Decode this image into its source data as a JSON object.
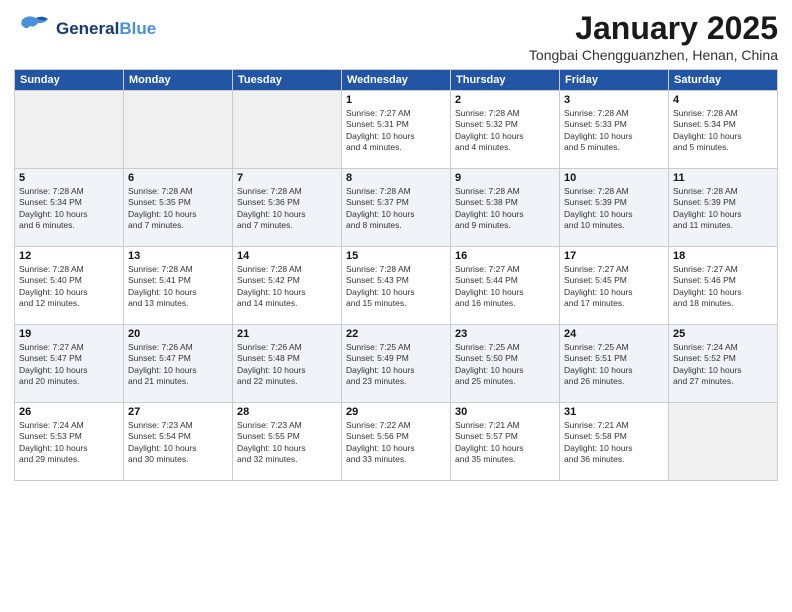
{
  "header": {
    "logo_general": "General",
    "logo_blue": "Blue",
    "month_title": "January 2025",
    "subtitle": "Tongbai Chengguanzhen, Henan, China"
  },
  "days_of_week": [
    "Sunday",
    "Monday",
    "Tuesday",
    "Wednesday",
    "Thursday",
    "Friday",
    "Saturday"
  ],
  "weeks": [
    [
      {
        "day": "",
        "lines": []
      },
      {
        "day": "",
        "lines": []
      },
      {
        "day": "",
        "lines": []
      },
      {
        "day": "1",
        "lines": [
          "Sunrise: 7:27 AM",
          "Sunset: 5:31 PM",
          "Daylight: 10 hours",
          "and 4 minutes."
        ]
      },
      {
        "day": "2",
        "lines": [
          "Sunrise: 7:28 AM",
          "Sunset: 5:32 PM",
          "Daylight: 10 hours",
          "and 4 minutes."
        ]
      },
      {
        "day": "3",
        "lines": [
          "Sunrise: 7:28 AM",
          "Sunset: 5:33 PM",
          "Daylight: 10 hours",
          "and 5 minutes."
        ]
      },
      {
        "day": "4",
        "lines": [
          "Sunrise: 7:28 AM",
          "Sunset: 5:34 PM",
          "Daylight: 10 hours",
          "and 5 minutes."
        ]
      }
    ],
    [
      {
        "day": "5",
        "lines": [
          "Sunrise: 7:28 AM",
          "Sunset: 5:34 PM",
          "Daylight: 10 hours",
          "and 6 minutes."
        ]
      },
      {
        "day": "6",
        "lines": [
          "Sunrise: 7:28 AM",
          "Sunset: 5:35 PM",
          "Daylight: 10 hours",
          "and 7 minutes."
        ]
      },
      {
        "day": "7",
        "lines": [
          "Sunrise: 7:28 AM",
          "Sunset: 5:36 PM",
          "Daylight: 10 hours",
          "and 7 minutes."
        ]
      },
      {
        "day": "8",
        "lines": [
          "Sunrise: 7:28 AM",
          "Sunset: 5:37 PM",
          "Daylight: 10 hours",
          "and 8 minutes."
        ]
      },
      {
        "day": "9",
        "lines": [
          "Sunrise: 7:28 AM",
          "Sunset: 5:38 PM",
          "Daylight: 10 hours",
          "and 9 minutes."
        ]
      },
      {
        "day": "10",
        "lines": [
          "Sunrise: 7:28 AM",
          "Sunset: 5:39 PM",
          "Daylight: 10 hours",
          "and 10 minutes."
        ]
      },
      {
        "day": "11",
        "lines": [
          "Sunrise: 7:28 AM",
          "Sunset: 5:39 PM",
          "Daylight: 10 hours",
          "and 11 minutes."
        ]
      }
    ],
    [
      {
        "day": "12",
        "lines": [
          "Sunrise: 7:28 AM",
          "Sunset: 5:40 PM",
          "Daylight: 10 hours",
          "and 12 minutes."
        ]
      },
      {
        "day": "13",
        "lines": [
          "Sunrise: 7:28 AM",
          "Sunset: 5:41 PM",
          "Daylight: 10 hours",
          "and 13 minutes."
        ]
      },
      {
        "day": "14",
        "lines": [
          "Sunrise: 7:28 AM",
          "Sunset: 5:42 PM",
          "Daylight: 10 hours",
          "and 14 minutes."
        ]
      },
      {
        "day": "15",
        "lines": [
          "Sunrise: 7:28 AM",
          "Sunset: 5:43 PM",
          "Daylight: 10 hours",
          "and 15 minutes."
        ]
      },
      {
        "day": "16",
        "lines": [
          "Sunrise: 7:27 AM",
          "Sunset: 5:44 PM",
          "Daylight: 10 hours",
          "and 16 minutes."
        ]
      },
      {
        "day": "17",
        "lines": [
          "Sunrise: 7:27 AM",
          "Sunset: 5:45 PM",
          "Daylight: 10 hours",
          "and 17 minutes."
        ]
      },
      {
        "day": "18",
        "lines": [
          "Sunrise: 7:27 AM",
          "Sunset: 5:46 PM",
          "Daylight: 10 hours",
          "and 18 minutes."
        ]
      }
    ],
    [
      {
        "day": "19",
        "lines": [
          "Sunrise: 7:27 AM",
          "Sunset: 5:47 PM",
          "Daylight: 10 hours",
          "and 20 minutes."
        ]
      },
      {
        "day": "20",
        "lines": [
          "Sunrise: 7:26 AM",
          "Sunset: 5:47 PM",
          "Daylight: 10 hours",
          "and 21 minutes."
        ]
      },
      {
        "day": "21",
        "lines": [
          "Sunrise: 7:26 AM",
          "Sunset: 5:48 PM",
          "Daylight: 10 hours",
          "and 22 minutes."
        ]
      },
      {
        "day": "22",
        "lines": [
          "Sunrise: 7:25 AM",
          "Sunset: 5:49 PM",
          "Daylight: 10 hours",
          "and 23 minutes."
        ]
      },
      {
        "day": "23",
        "lines": [
          "Sunrise: 7:25 AM",
          "Sunset: 5:50 PM",
          "Daylight: 10 hours",
          "and 25 minutes."
        ]
      },
      {
        "day": "24",
        "lines": [
          "Sunrise: 7:25 AM",
          "Sunset: 5:51 PM",
          "Daylight: 10 hours",
          "and 26 minutes."
        ]
      },
      {
        "day": "25",
        "lines": [
          "Sunrise: 7:24 AM",
          "Sunset: 5:52 PM",
          "Daylight: 10 hours",
          "and 27 minutes."
        ]
      }
    ],
    [
      {
        "day": "26",
        "lines": [
          "Sunrise: 7:24 AM",
          "Sunset: 5:53 PM",
          "Daylight: 10 hours",
          "and 29 minutes."
        ]
      },
      {
        "day": "27",
        "lines": [
          "Sunrise: 7:23 AM",
          "Sunset: 5:54 PM",
          "Daylight: 10 hours",
          "and 30 minutes."
        ]
      },
      {
        "day": "28",
        "lines": [
          "Sunrise: 7:23 AM",
          "Sunset: 5:55 PM",
          "Daylight: 10 hours",
          "and 32 minutes."
        ]
      },
      {
        "day": "29",
        "lines": [
          "Sunrise: 7:22 AM",
          "Sunset: 5:56 PM",
          "Daylight: 10 hours",
          "and 33 minutes."
        ]
      },
      {
        "day": "30",
        "lines": [
          "Sunrise: 7:21 AM",
          "Sunset: 5:57 PM",
          "Daylight: 10 hours",
          "and 35 minutes."
        ]
      },
      {
        "day": "31",
        "lines": [
          "Sunrise: 7:21 AM",
          "Sunset: 5:58 PM",
          "Daylight: 10 hours",
          "and 36 minutes."
        ]
      },
      {
        "day": "",
        "lines": []
      }
    ]
  ]
}
